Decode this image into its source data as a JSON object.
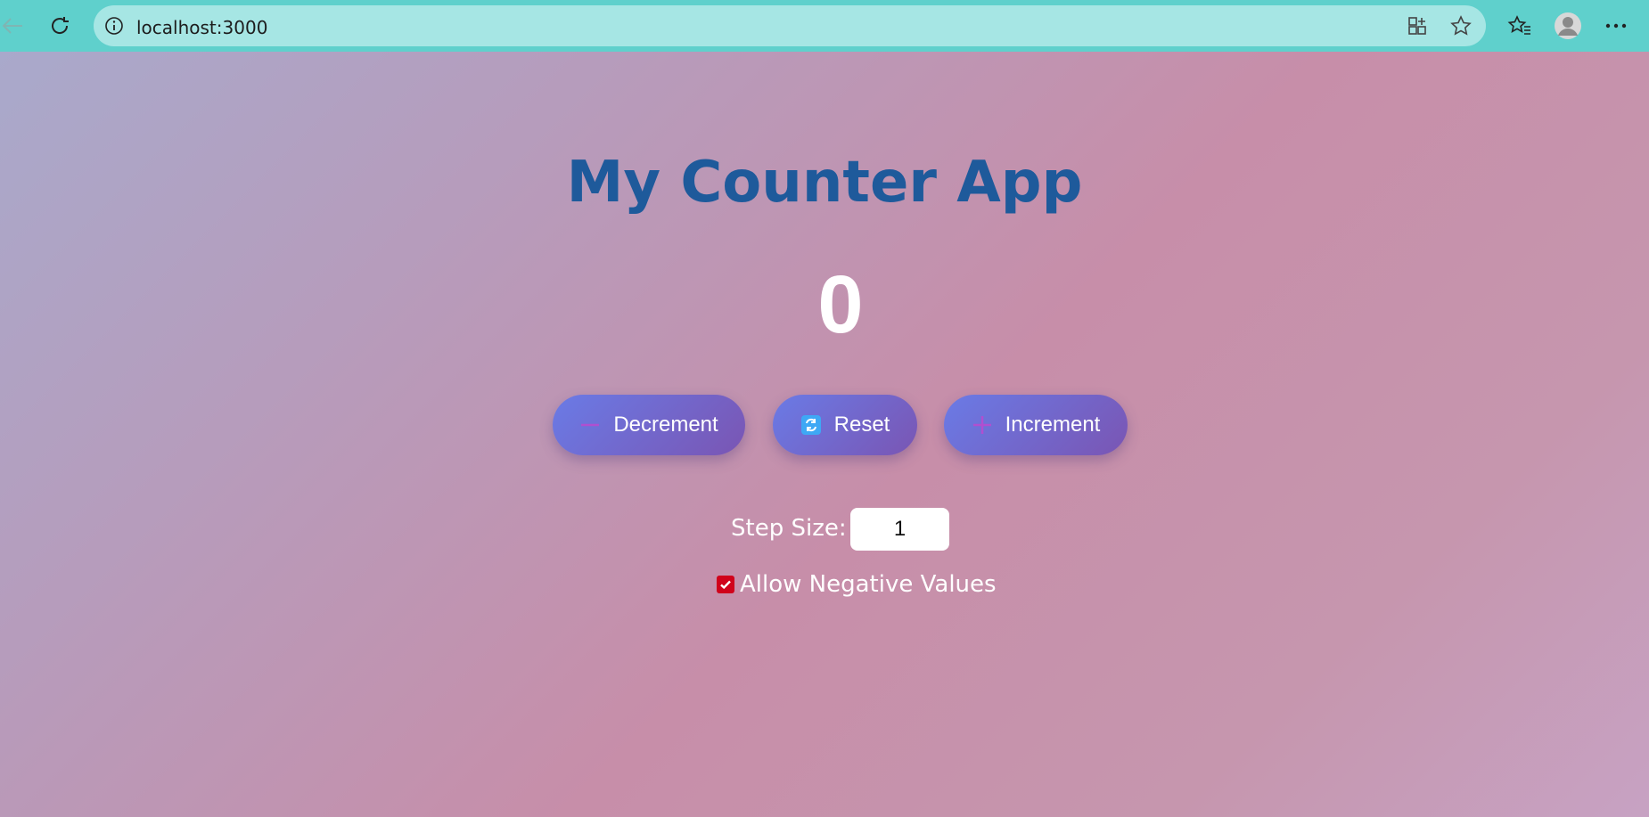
{
  "browser": {
    "url": "localhost:3000"
  },
  "app": {
    "title": "My Counter App",
    "count": "0",
    "buttons": {
      "decrement": "Decrement",
      "reset": "Reset",
      "increment": "Increment"
    },
    "step": {
      "label": "Step Size:",
      "value": "1"
    },
    "allow_negative": {
      "label": "Allow Negative Values",
      "checked": true
    }
  },
  "colors": {
    "title": "#1e5a9b",
    "button_start": "#6a7be6",
    "button_end": "#7a55b3",
    "checkbox": "#d0021b",
    "browser_bar": "#5fd0cc"
  }
}
